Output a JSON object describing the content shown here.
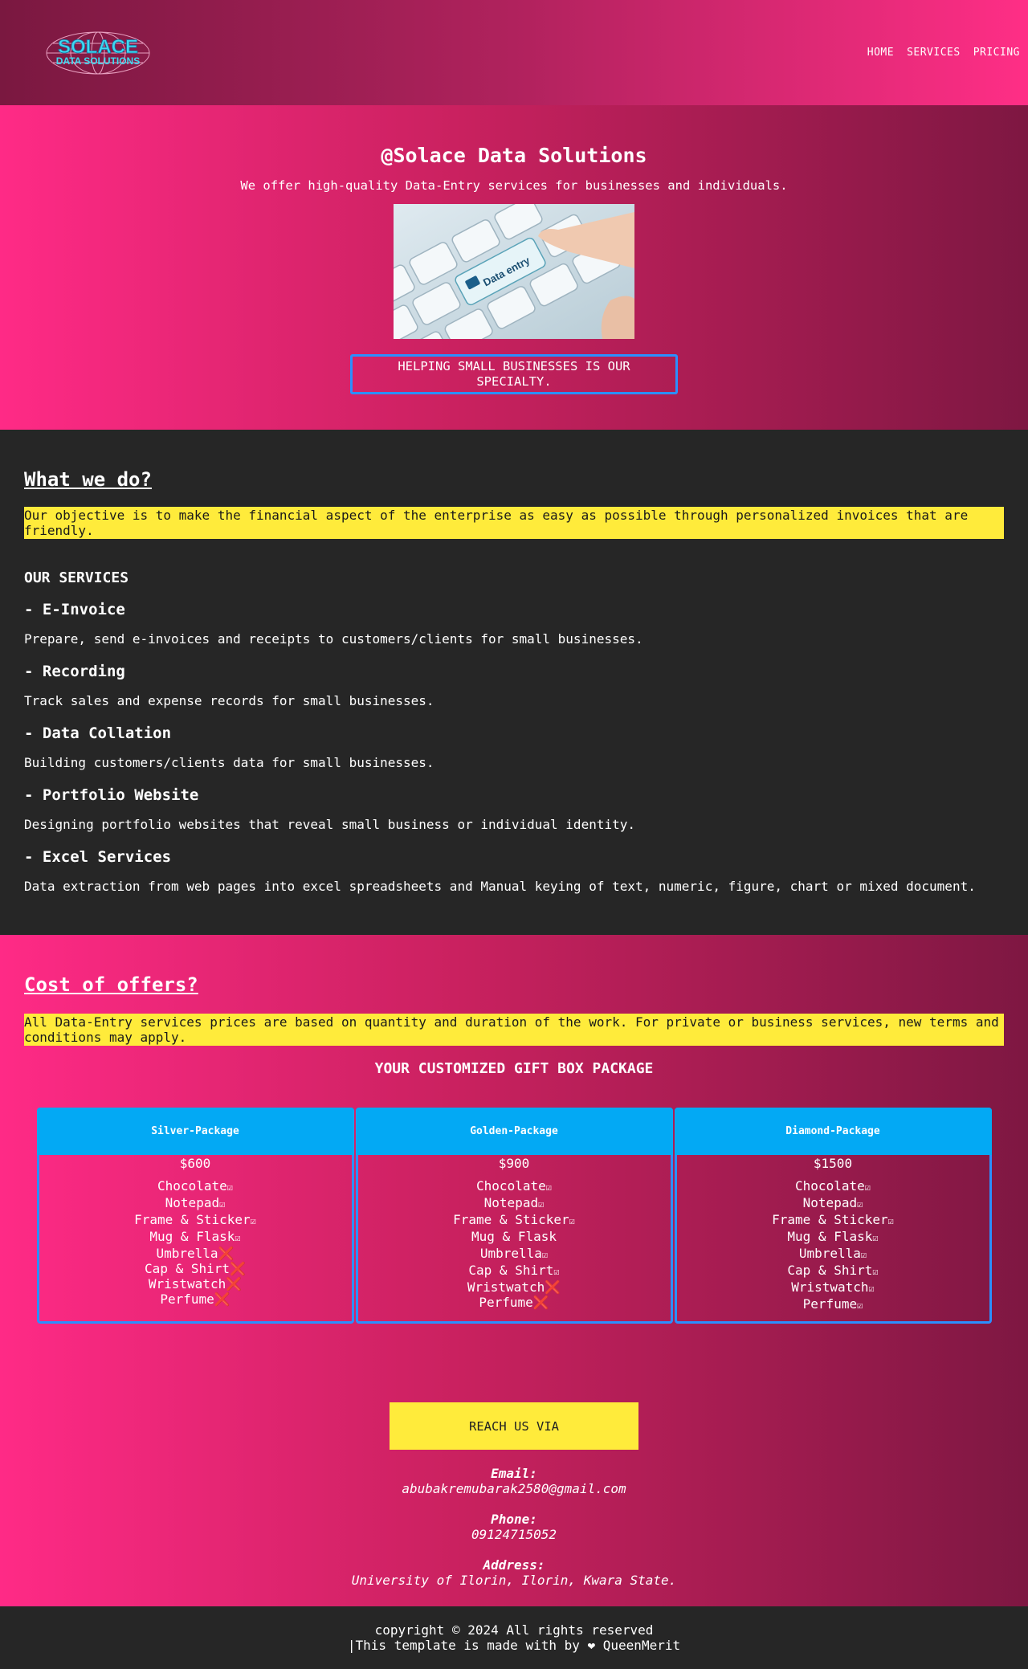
{
  "header": {
    "logo_top": "SOLACE",
    "logo_bottom": "DATA SOLUTIONS",
    "nav": [
      "HOME",
      "SERVICES",
      "PRICING"
    ]
  },
  "hero": {
    "title": "@Solace Data Solutions",
    "subtitle": "We offer high-quality Data-Entry services for businesses and individuals.",
    "image_key_label": "Data entry",
    "tagline": "HELPING SMALL BUSINESSES IS OUR SPECIALTY."
  },
  "about": {
    "title": "What we do?",
    "objective": "Our objective is to make the financial aspect of the enterprise as easy as possible through personalized invoices that are friendly.",
    "services_heading": "OUR SERVICES",
    "services": [
      {
        "title": "- E-Invoice",
        "desc": "Prepare, send e-invoices and receipts to customers/clients for small businesses."
      },
      {
        "title": "- Recording",
        "desc": "Track sales and expense records for small businesses."
      },
      {
        "title": "- Data Collation",
        "desc": "Building customers/clients data for small businesses."
      },
      {
        "title": "- Portfolio Website",
        "desc": "Designing portfolio websites that reveal small business or individual identity."
      },
      {
        "title": "- Excel Services",
        "desc": "Data extraction from web pages into excel spreadsheets and Manual keying of text, numeric, figure, chart or mixed document."
      }
    ]
  },
  "offers": {
    "title": "Cost of offers?",
    "note": "All Data-Entry services prices are based on quantity and duration of the work. For private or business services, new terms and conditions may apply.",
    "packages_heading": "YOUR CUSTOMIZED GIFT BOX PACKAGE",
    "packages": [
      {
        "name": "Silver-Package",
        "price": "$600",
        "items": [
          {
            "label": "Chocolate",
            "mark": "☑"
          },
          {
            "label": "Notepad",
            "mark": "☑"
          },
          {
            "label": "Frame & Sticker",
            "mark": "☑"
          },
          {
            "label": "Mug & Flask",
            "mark": "☑"
          },
          {
            "label": "Umbrella",
            "mark": "❌"
          },
          {
            "label": "Cap & Shirt",
            "mark": "❌"
          },
          {
            "label": "Wristwatch",
            "mark": "❌"
          },
          {
            "label": "Perfume",
            "mark": "❌"
          }
        ]
      },
      {
        "name": "Golden-Package",
        "price": "$900",
        "items": [
          {
            "label": "Chocolate",
            "mark": "☑"
          },
          {
            "label": "Notepad",
            "mark": "☑"
          },
          {
            "label": "Frame & Sticker",
            "mark": "☑"
          },
          {
            "label": "Mug & Flask",
            "mark": ""
          },
          {
            "label": "Umbrella",
            "mark": "☑"
          },
          {
            "label": "Cap & Shirt",
            "mark": "☑"
          },
          {
            "label": "Wristwatch",
            "mark": "❌"
          },
          {
            "label": "Perfume",
            "mark": "❌"
          }
        ]
      },
      {
        "name": "Diamond-Package",
        "price": "$1500",
        "items": [
          {
            "label": "Chocolate",
            "mark": "☑"
          },
          {
            "label": "Notepad",
            "mark": "☑"
          },
          {
            "label": "Frame & Sticker",
            "mark": "☑"
          },
          {
            "label": "Mug & Flask",
            "mark": "☑"
          },
          {
            "label": "Umbrella",
            "mark": "☑"
          },
          {
            "label": "Cap & Shirt",
            "mark": "☑"
          },
          {
            "label": "Wristwatch",
            "mark": "☑"
          },
          {
            "label": "Perfume",
            "mark": "☑"
          }
        ]
      }
    ],
    "reach_button": "REACH US VIA",
    "contact": {
      "email_label": "Email:",
      "email": "abubakremubarak2580@gmail.com",
      "phone_label": "Phone:",
      "phone": "09124715052",
      "address_label": "Address:",
      "address": "University of Ilorin, Ilorin, Kwara State."
    }
  },
  "footer": {
    "line1": "copyright © 2024 All rights reserved",
    "line2": "|This template is made with by ❤ QueenMerit"
  },
  "colors": {
    "pink": "#ff2a86",
    "maroon": "#7e1742",
    "dark": "#262626",
    "yellow": "#ffeb3b",
    "blue": "#03a9f4",
    "border_blue": "#2b8fff",
    "cross": "#ff5722"
  }
}
